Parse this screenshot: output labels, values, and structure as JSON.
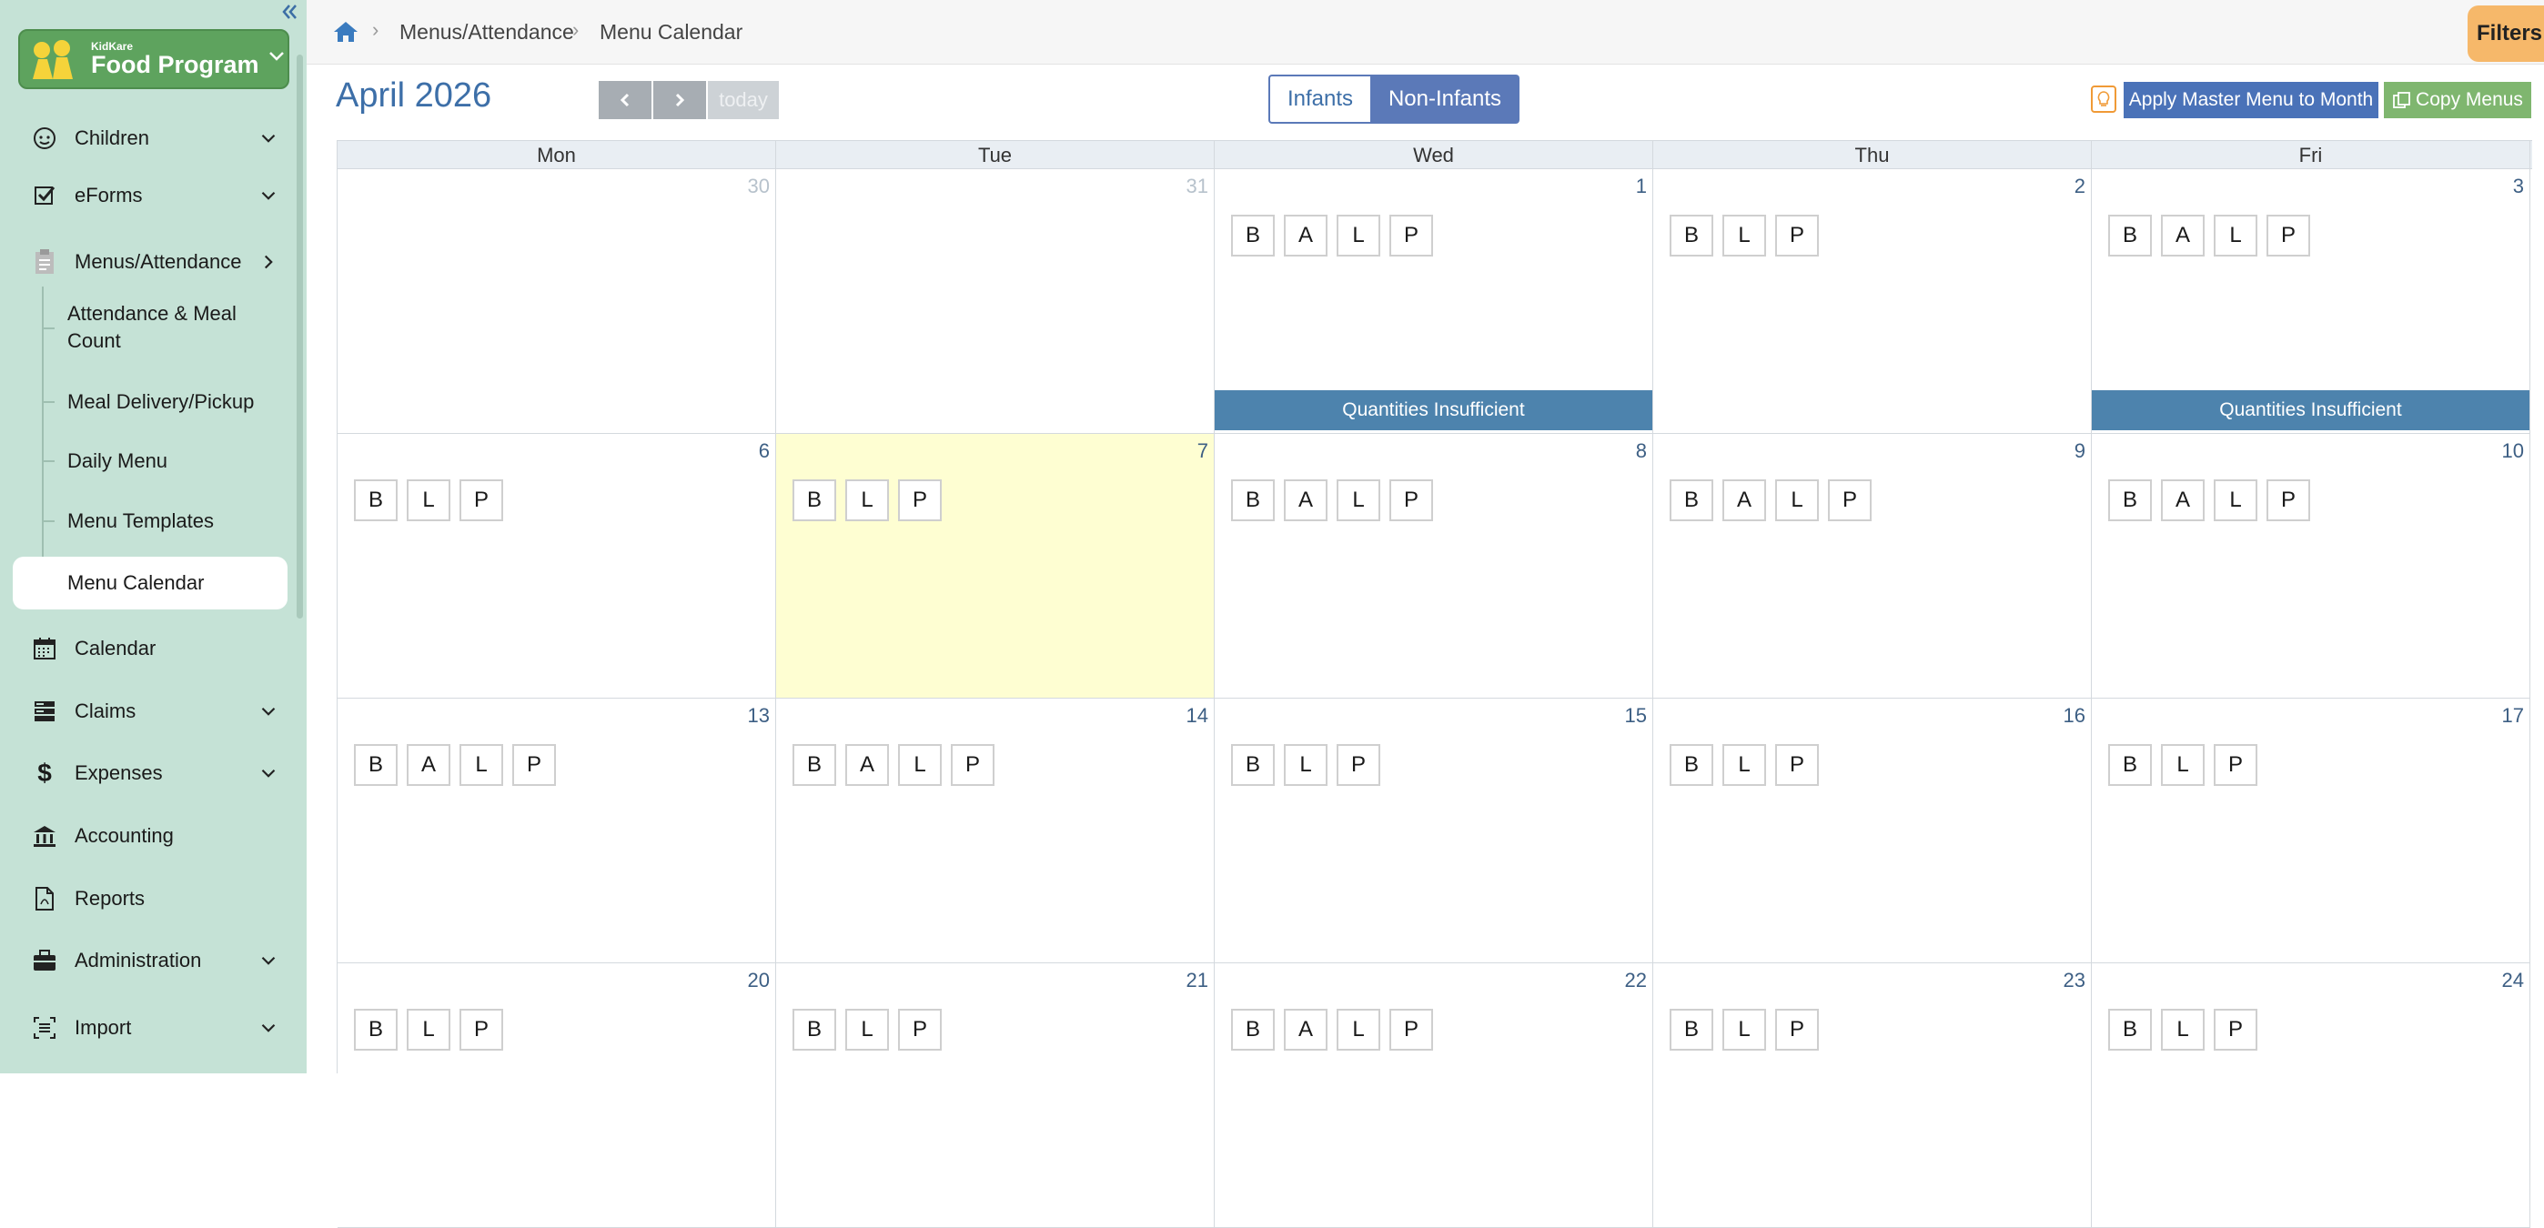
{
  "sidebar": {
    "logo_small": "KidKare",
    "logo_big": "Food Program",
    "items": [
      {
        "label": "Children"
      },
      {
        "label": "eForms"
      },
      {
        "label": "Menus/Attendance"
      },
      {
        "label": "Calendar"
      },
      {
        "label": "Claims"
      },
      {
        "label": "Expenses"
      },
      {
        "label": "Accounting"
      },
      {
        "label": "Reports"
      },
      {
        "label": "Administration"
      },
      {
        "label": "Import"
      }
    ],
    "sub_items": [
      {
        "label": "Attendance & Meal Count"
      },
      {
        "label": "Meal Delivery/Pickup"
      },
      {
        "label": "Daily Menu"
      },
      {
        "label": "Menu Templates"
      },
      {
        "label": "Menu Calendar"
      }
    ]
  },
  "breadcrumb": {
    "section": "Menus/Attendance",
    "page": "Menu Calendar"
  },
  "filters_label": "Filters",
  "toolbar": {
    "month_title": "April 2026",
    "today_label": "today",
    "infants_label": "Infants",
    "noninfants_label": "Non-Infants",
    "apply_label": "Apply Master Menu to Month",
    "copy_label": "Copy Menus"
  },
  "calendar": {
    "weekdays": [
      "Mon",
      "Tue",
      "Wed",
      "Thu",
      "Fri"
    ],
    "banner_label": "Quantities Insufficient",
    "weeks": [
      [
        {
          "num": "30",
          "other": true,
          "meals": [],
          "banner": false
        },
        {
          "num": "31",
          "other": true,
          "meals": [],
          "banner": false
        },
        {
          "num": "1",
          "meals": [
            "B",
            "A",
            "L",
            "P"
          ],
          "banner": true
        },
        {
          "num": "2",
          "meals": [
            "B",
            "L",
            "P"
          ],
          "banner": false
        },
        {
          "num": "3",
          "meals": [
            "B",
            "A",
            "L",
            "P"
          ],
          "banner": true
        }
      ],
      [
        {
          "num": "6",
          "meals": [
            "B",
            "L",
            "P"
          ],
          "banner": false
        },
        {
          "num": "7",
          "today": true,
          "meals": [
            "B",
            "L",
            "P"
          ],
          "banner": false
        },
        {
          "num": "8",
          "meals": [
            "B",
            "A",
            "L",
            "P"
          ],
          "banner": false
        },
        {
          "num": "9",
          "meals": [
            "B",
            "A",
            "L",
            "P"
          ],
          "banner": false
        },
        {
          "num": "10",
          "meals": [
            "B",
            "A",
            "L",
            "P"
          ],
          "banner": false
        }
      ],
      [
        {
          "num": "13",
          "meals": [
            "B",
            "A",
            "L",
            "P"
          ],
          "banner": false
        },
        {
          "num": "14",
          "meals": [
            "B",
            "A",
            "L",
            "P"
          ],
          "banner": false
        },
        {
          "num": "15",
          "meals": [
            "B",
            "L",
            "P"
          ],
          "banner": false
        },
        {
          "num": "16",
          "meals": [
            "B",
            "L",
            "P"
          ],
          "banner": false
        },
        {
          "num": "17",
          "meals": [
            "B",
            "L",
            "P"
          ],
          "banner": false
        }
      ],
      [
        {
          "num": "20",
          "meals": [
            "B",
            "L",
            "P"
          ],
          "banner": false
        },
        {
          "num": "21",
          "meals": [
            "B",
            "L",
            "P"
          ],
          "banner": false
        },
        {
          "num": "22",
          "meals": [
            "B",
            "A",
            "L",
            "P"
          ],
          "banner": false
        },
        {
          "num": "23",
          "meals": [
            "B",
            "L",
            "P"
          ],
          "banner": false
        },
        {
          "num": "24",
          "meals": [
            "B",
            "L",
            "P"
          ],
          "banner": false
        }
      ]
    ]
  }
}
